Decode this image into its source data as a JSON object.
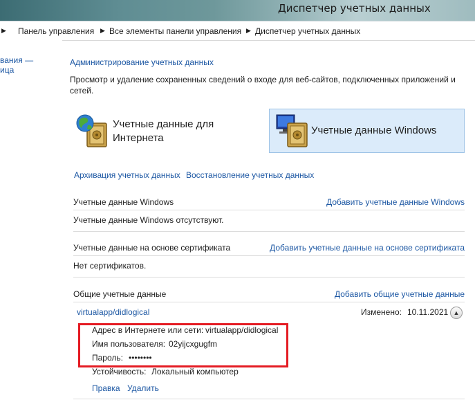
{
  "window": {
    "title": "Диспетчер учетных данных"
  },
  "breadcrumb": [
    "Панель управления",
    "Все элементы панели управления",
    "Диспетчер учетных данных"
  ],
  "sidebar": {
    "lines": [
      "вания —",
      "ица"
    ]
  },
  "main": {
    "admin_link": "Администрирование учетных данных",
    "description_line1": "Просмотр и удаление сохраненных сведений о входе для веб-сайтов, подключенных приложений и",
    "description_line2": "сетей.",
    "tiles": [
      {
        "label_line1": "Учетные данные для",
        "label_line2": "Интернета"
      },
      {
        "label": "Учетные данные Windows"
      }
    ],
    "backup_link": "Архивация учетных данных",
    "restore_link": "Восстановление учетных данных",
    "sections": {
      "windows": {
        "header": "Учетные данные Windows",
        "add_link": "Добавить учетные данные Windows",
        "empty": "Учетные данные Windows отсутствуют."
      },
      "certificate": {
        "header": "Учетные данные на основе сертификата",
        "add_link": "Добавить учетные данные на основе сертификата",
        "empty": "Нет сертификатов."
      },
      "generic": {
        "header": "Общие учетные данные",
        "add_link": "Добавить общие учетные данные",
        "entry": {
          "name": "virtualapp/didlogical",
          "modified_label": "Изменено:",
          "modified_value": "10.11.2021",
          "address_label": "Адрес в Интернете или сети:",
          "address_value": "virtualapp/didlogical",
          "username_label": "Имя пользователя:",
          "username_value": "02yijcxgugfm",
          "password_label": "Пароль:",
          "password_value": "••••••••",
          "persistence_label": "Устойчивость:",
          "persistence_value": "Локальный компьютер",
          "edit_link": "Правка",
          "delete_link": "Удалить"
        }
      }
    }
  },
  "colors": {
    "link": "#1c57a3",
    "highlight_box": "#e41b23",
    "selected_tile": "#dbebfa"
  }
}
